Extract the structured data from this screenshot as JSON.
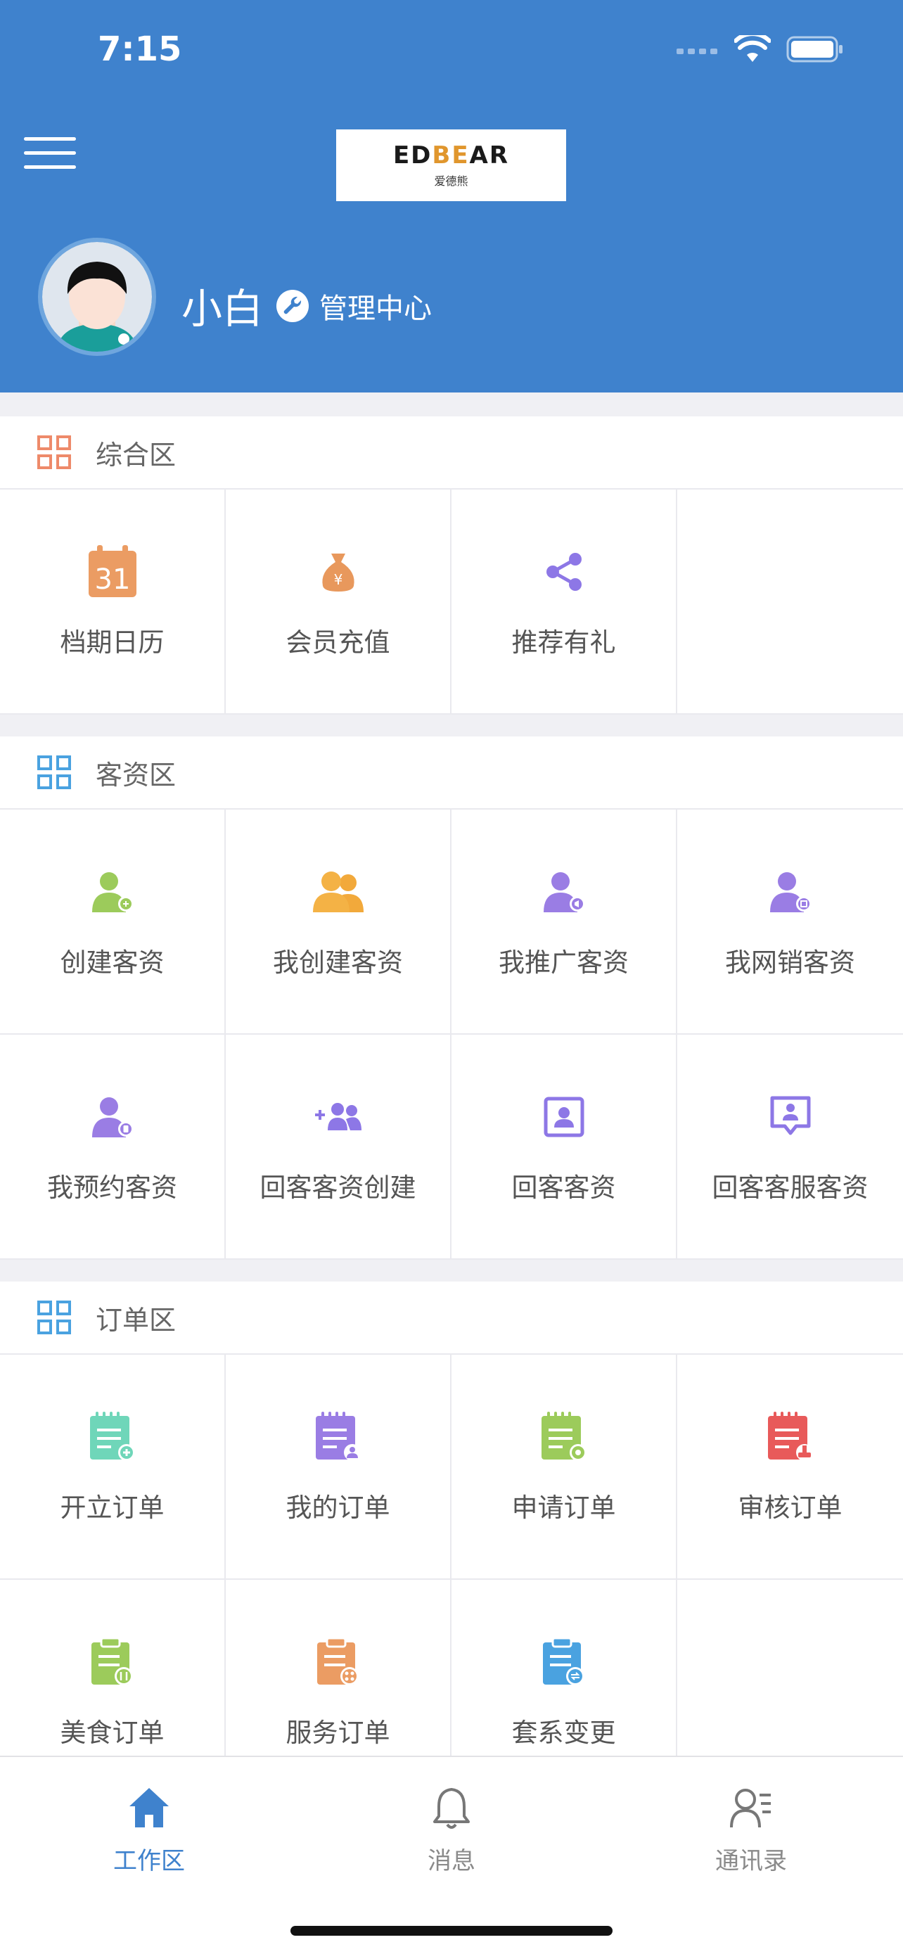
{
  "status_bar": {
    "time": "7:15"
  },
  "header": {
    "logo_brand_left": "ED",
    "logo_brand_mid": "BE",
    "logo_brand_right": "AR",
    "logo_sub": "爱德熊",
    "user_name": "小白",
    "admin_label": "管理中心"
  },
  "colors": {
    "header_bg": "#3f82cd",
    "active_tab": "#3f82cd",
    "page_bg": "#f0f0f4"
  },
  "sections": {
    "general": {
      "title": "综合区",
      "items": [
        {
          "label": "档期日历",
          "icon": "calendar-icon",
          "value": "31"
        },
        {
          "label": "会员充值",
          "icon": "money-bag-icon"
        },
        {
          "label": "推荐有礼",
          "icon": "share-icon"
        }
      ]
    },
    "clients": {
      "title": "客资区",
      "items": [
        {
          "label": "创建客资",
          "icon": "user-add-icon"
        },
        {
          "label": "我创建客资",
          "icon": "users-icon"
        },
        {
          "label": "我推广客资",
          "icon": "user-promote-icon"
        },
        {
          "label": "我网销客资",
          "icon": "user-online-icon"
        },
        {
          "label": "我预约客资",
          "icon": "user-appointment-icon"
        },
        {
          "label": "回客客资创建",
          "icon": "group-add-icon"
        },
        {
          "label": "回客客资",
          "icon": "contact-card-icon"
        },
        {
          "label": "回客客服客资",
          "icon": "service-chat-icon"
        }
      ]
    },
    "orders": {
      "title": "订单区",
      "items": [
        {
          "label": "开立订单",
          "icon": "order-add-icon"
        },
        {
          "label": "我的订单",
          "icon": "my-order-icon"
        },
        {
          "label": "申请订单",
          "icon": "apply-order-icon"
        },
        {
          "label": "审核订单",
          "icon": "review-order-icon"
        },
        {
          "label": "美食订单",
          "icon": "food-order-icon"
        },
        {
          "label": "服务订单",
          "icon": "service-order-icon"
        },
        {
          "label": "套系变更",
          "icon": "package-change-icon"
        }
      ]
    }
  },
  "tabbar": {
    "items": [
      {
        "label": "工作区",
        "icon": "home-icon",
        "active": true
      },
      {
        "label": "消息",
        "icon": "bell-icon",
        "active": false
      },
      {
        "label": "通讯录",
        "icon": "contacts-icon",
        "active": false
      }
    ]
  }
}
